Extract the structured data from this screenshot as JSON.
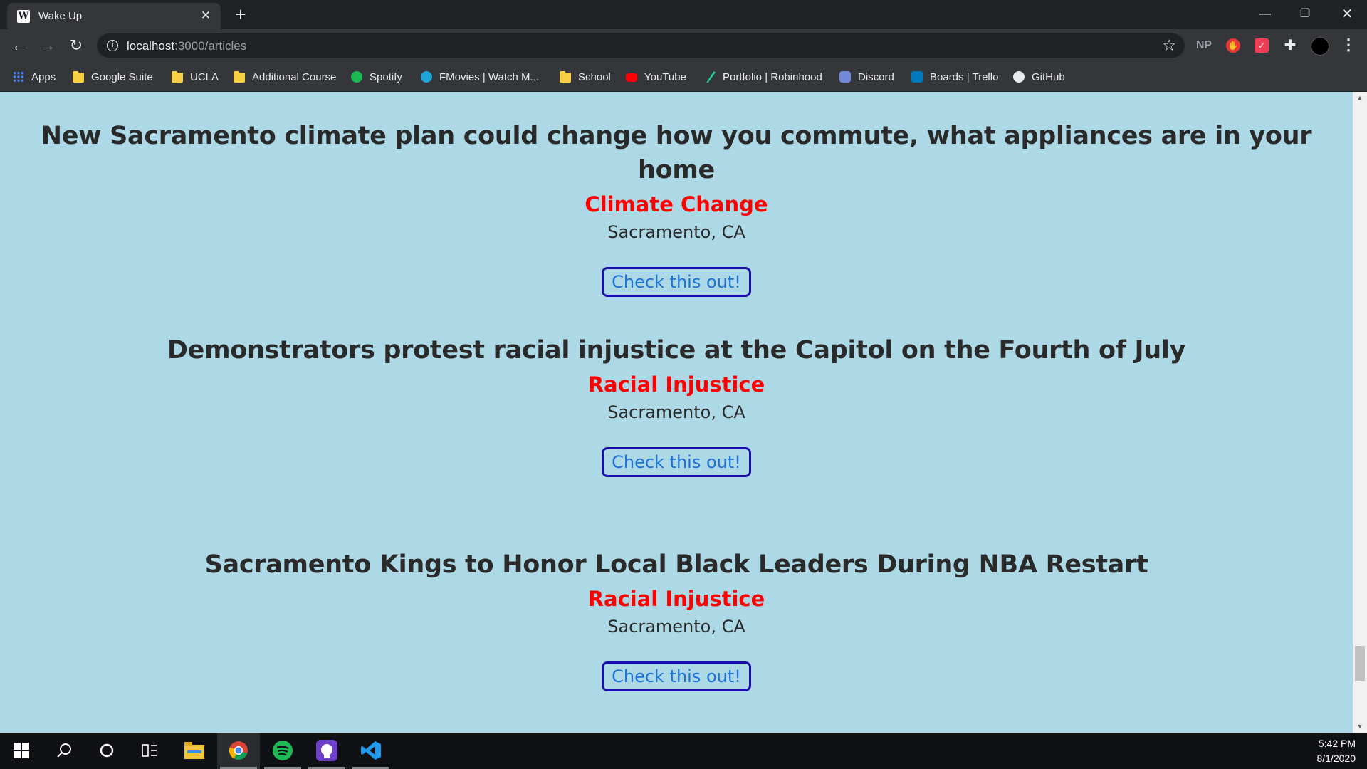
{
  "browser": {
    "tab_title": "Wake Up",
    "tab_favicon_letter": "W",
    "url_host": "localhost",
    "url_path": ":3000/articles",
    "extensions": [
      "NP"
    ]
  },
  "bookmarks": [
    {
      "label": "Apps",
      "icon": "apps-grid-icon"
    },
    {
      "label": "Google Suite",
      "icon": "folder-icon"
    },
    {
      "label": "UCLA",
      "icon": "folder-icon"
    },
    {
      "label": "Additional Course",
      "icon": "folder-icon"
    },
    {
      "label": "Spotify",
      "icon": "spotify-icon"
    },
    {
      "label": "FMovies | Watch M...",
      "icon": "fmovies-icon"
    },
    {
      "label": "School",
      "icon": "folder-icon"
    },
    {
      "label": "YouTube",
      "icon": "youtube-icon"
    },
    {
      "label": "Portfolio | Robinhood",
      "icon": "robinhood-icon"
    },
    {
      "label": "Discord",
      "icon": "discord-icon"
    },
    {
      "label": "Boards | Trello",
      "icon": "trello-icon"
    },
    {
      "label": "GitHub",
      "icon": "github-icon"
    }
  ],
  "articles": [
    {
      "title": "New Sacramento climate plan could change how you commute, what appliances are in your home",
      "category": "Climate Change",
      "location": "Sacramento, CA",
      "button": "Check this out!"
    },
    {
      "title": "Demonstrators protest racial injustice at the Capitol on the Fourth of July",
      "category": "Racial Injustice",
      "location": "Sacramento, CA",
      "button": "Check this out!"
    },
    {
      "title": "Sacramento Kings to Honor Local Black Leaders During NBA Restart",
      "category": "Racial Injustice",
      "location": "Sacramento, CA",
      "button": "Check this out!"
    }
  ],
  "taskbar": {
    "time": "5:42 PM",
    "date": "8/1/2020"
  },
  "colors": {
    "page_background": "#add8e6",
    "category": "#ff0000",
    "button_border": "#1a0dab",
    "button_text": "#1e73d8"
  }
}
